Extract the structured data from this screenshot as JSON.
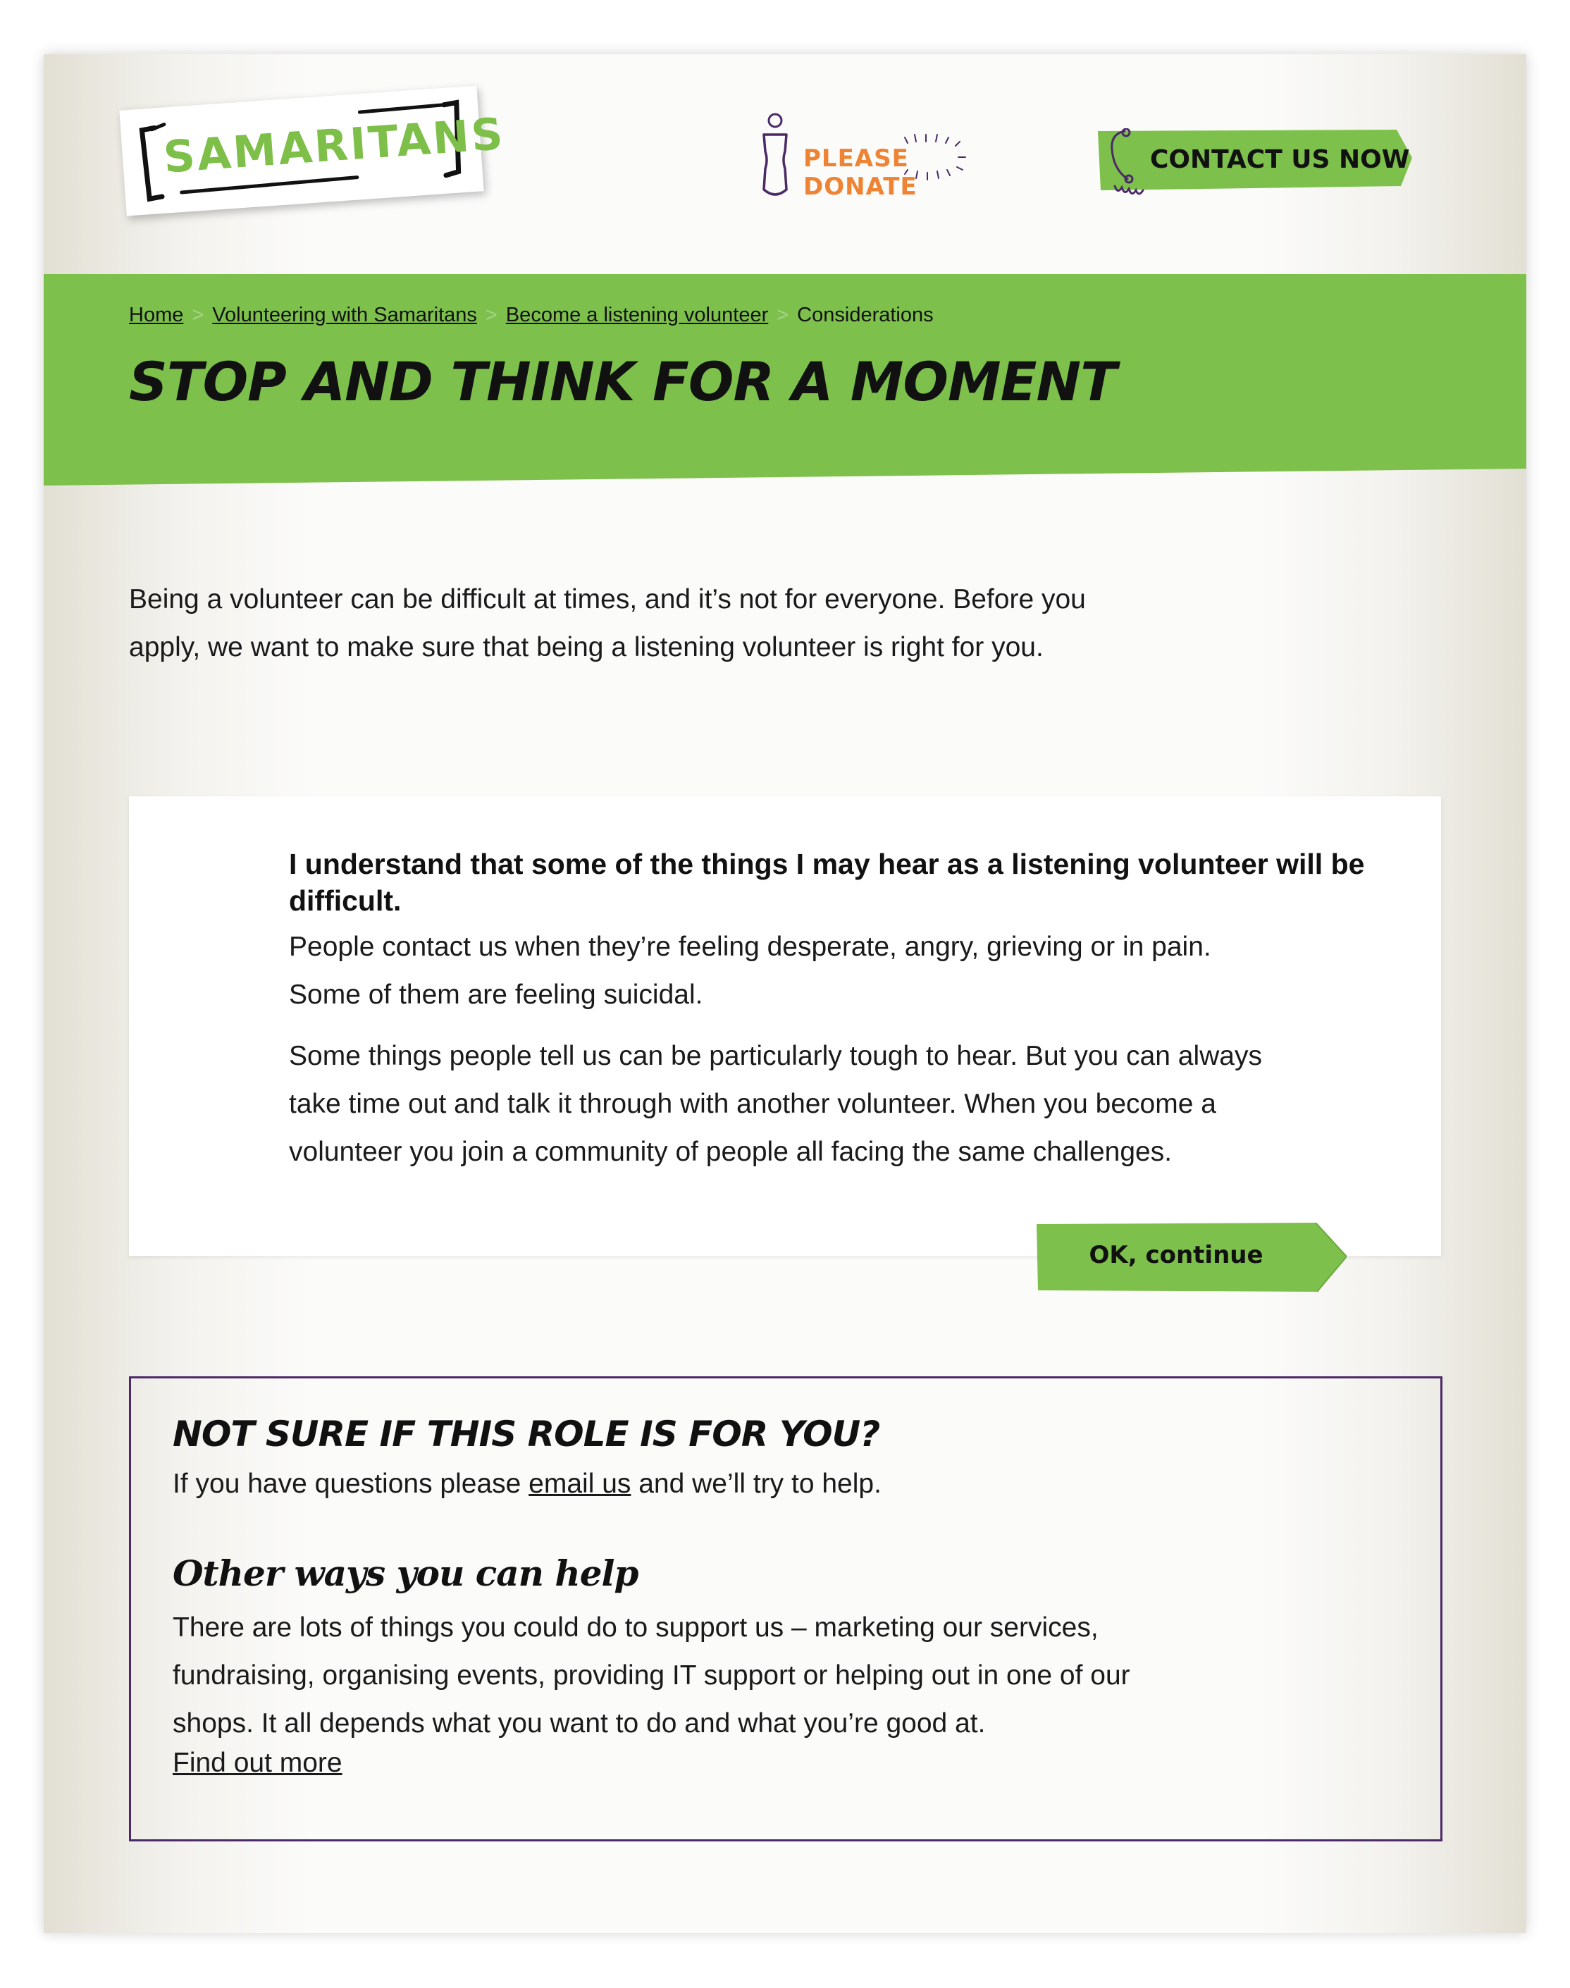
{
  "header": {
    "logo_text": "SAMARITANS",
    "donate_text": "PLEASE DONATE",
    "contact_text": "CONTACT US NOW"
  },
  "breadcrumb": {
    "items": [
      "Home",
      "Volunteering with Samaritans",
      "Become a listening volunteer"
    ],
    "current": "Considerations",
    "separator": ">"
  },
  "page_title": "STOP AND THINK FOR A MOMENT",
  "intro": {
    "line1": "Being a volunteer can be difficult at times, and it’s not for everyone. Before you",
    "line2": "apply, we want to make sure that being a listening volunteer is right for you."
  },
  "card": {
    "heading": "I understand that some of the things I may hear as a listening volunteer will be difficult.",
    "p1_line1": "People contact us when they’re feeling desperate, angry, grieving or in pain.",
    "p1_line2": "Some of them are feeling suicidal.",
    "p2_line1": "Some things people tell us can be particularly tough to hear. But you can always",
    "p2_line2": "take time out and talk it through with another volunteer. When you become a",
    "p2_line3": "volunteer you join a community of people all facing the same challenges.",
    "button": "OK, continue"
  },
  "help": {
    "title": "NOT SURE IF THIS ROLE IS FOR YOU?",
    "line_before": "If you have questions please ",
    "link": "email us",
    "line_after": " and we’ll try to help.",
    "other_title": "Other ways you can help",
    "other_line1": "There are lots of things you could do to support us – marketing our services,",
    "other_line2": "fundraising, organising events, providing IT support or helping out in one of our",
    "other_line3": "shops. It all depends what you want to do and what you’re good at.",
    "find_more": "Find out more"
  },
  "colors": {
    "brand_green": "#7dc04b",
    "donate_orange": "#ee8433",
    "purple": "#4b2a68"
  }
}
